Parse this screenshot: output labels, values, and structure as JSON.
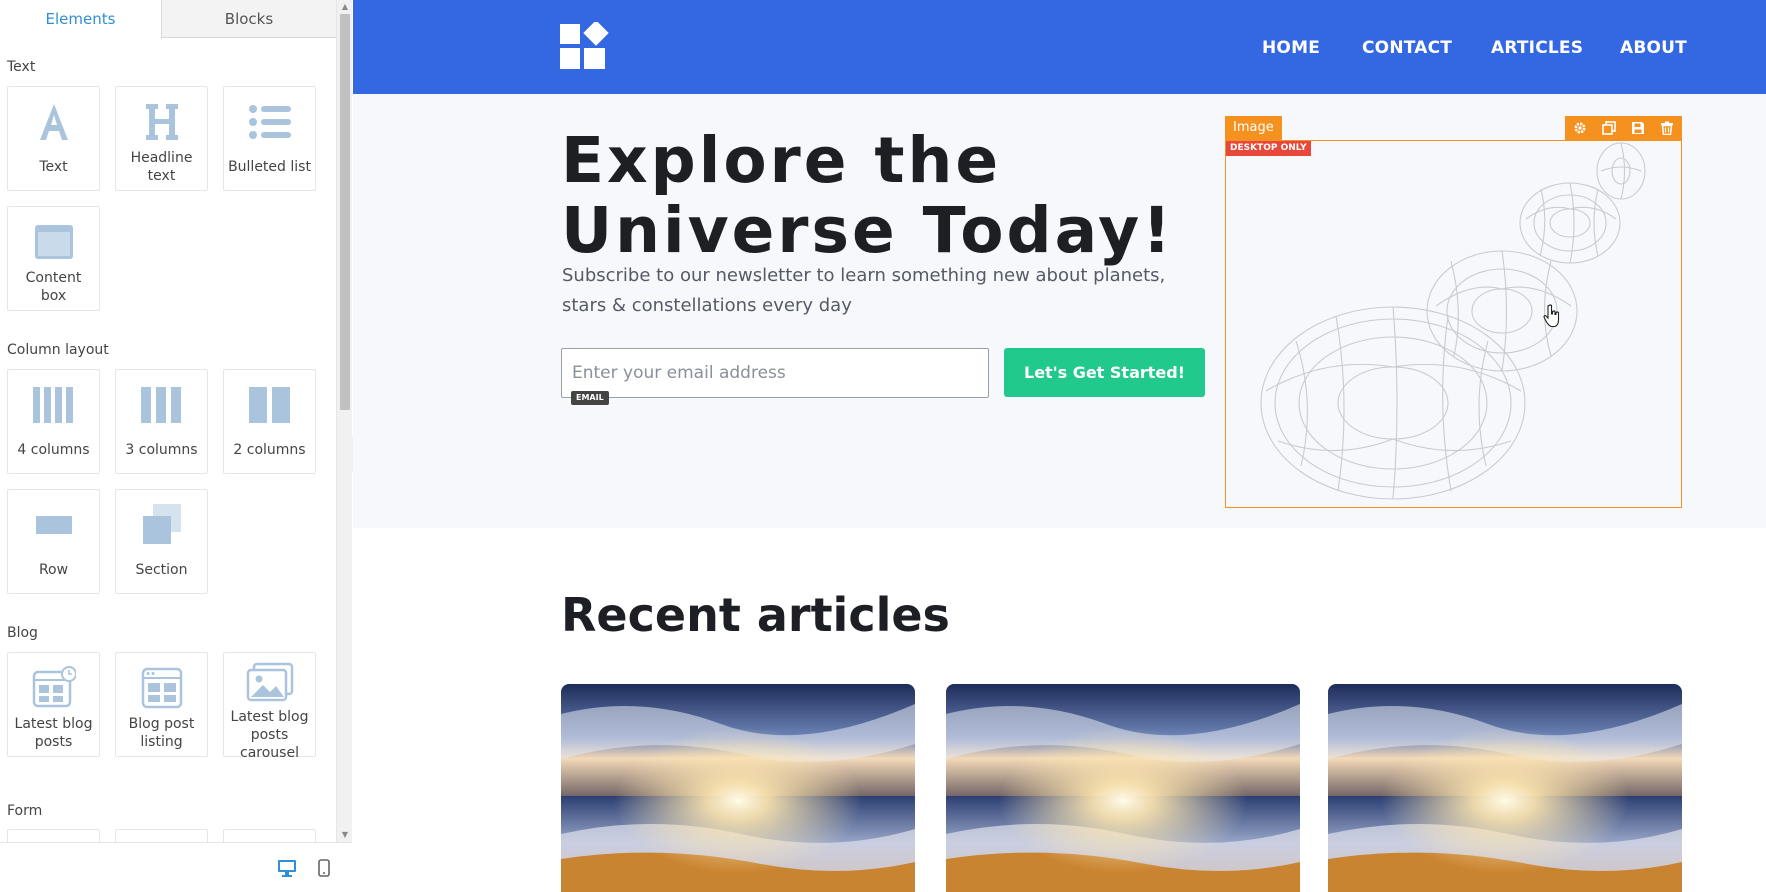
{
  "sidebar": {
    "tabs": [
      "Elements",
      "Blocks"
    ],
    "sections": {
      "text": {
        "label": "Text",
        "items": [
          "Text",
          "Headline text",
          "Bulleted list",
          "Content box"
        ]
      },
      "columns": {
        "label": "Column layout",
        "items": [
          "4 columns",
          "3 columns",
          "2 columns",
          "Row",
          "Section"
        ]
      },
      "blog": {
        "label": "Blog",
        "items": [
          "Latest blog posts",
          "Blog post listing",
          "Latest blog posts carousel"
        ]
      },
      "form": {
        "label": "Form"
      }
    },
    "icons": {
      "text": "letter-a-icon",
      "headline": "letter-h-icon",
      "bulleted": "list-icon",
      "content_box": "content-box-icon",
      "devices": [
        "desktop-icon",
        "mobile-icon"
      ]
    }
  },
  "site": {
    "nav": [
      "HOME",
      "CONTACT",
      "ARTICLES",
      "ABOUT"
    ],
    "hero": {
      "title_line1": "Explore the",
      "title_line2": "Universe Today!",
      "subtitle": "Subscribe to our newsletter to learn something new about planets, stars & constellations every day",
      "email_placeholder": "Enter your email address",
      "email_tag": "EMAIL",
      "cta": "Let's Get Started!"
    },
    "image_block": {
      "label": "Image",
      "badge": "DESKTOP ONLY",
      "tools": [
        "gear-icon",
        "copy-icon",
        "save-icon",
        "trash-icon"
      ]
    },
    "recent_title": "Recent articles"
  },
  "colors": {
    "nav_bg": "#3468e3",
    "cta": "#22c98c",
    "selection": "#f5911e",
    "badge": "#e8483c",
    "accent_tab": "#2f8fd8",
    "icon_blue": "#a9c4dc"
  }
}
